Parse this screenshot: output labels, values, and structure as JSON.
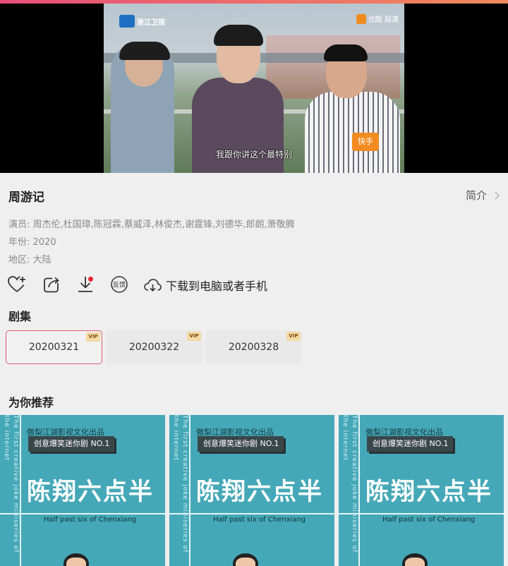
{
  "video": {
    "subtitle": "我跟你讲这个最特别",
    "channel_logo": "浙江卫视",
    "right_logo": "优酷 超清",
    "sponsor_tag": "快手"
  },
  "show": {
    "title": "周游记",
    "intro_label": "简介",
    "cast": "演员: 周杰伦,杜国璋,陈冠霖,蔡威泽,林俊杰,谢霆锋,刘德华,郎朗,萧敬腾",
    "year": "年份: 2020",
    "region": "地区: 大陆"
  },
  "actions": {
    "icons": [
      "heart-plus-icon",
      "share-icon",
      "download-icon",
      "feedback-icon"
    ],
    "feedback_label": "反馈",
    "download_pc_label": "下载到电脑或者手机"
  },
  "episodes": {
    "header": "剧集",
    "items": [
      {
        "label": "20200321",
        "badge": "VIP",
        "active": true
      },
      {
        "label": "20200322",
        "badge": "VIP",
        "active": false
      },
      {
        "label": "20200328",
        "badge": "VIP",
        "active": false
      }
    ]
  },
  "recommend": {
    "header": "为你推荐",
    "items": [
      {
        "studio": "傲梨江湖影视文化出品",
        "tag": "创意爆笑迷你剧 NO.1",
        "title": "陈翔六点半",
        "en": "Half past six of Chenxiang",
        "side_text": "The first creative joke miniseries of the internet"
      },
      {
        "studio": "傲梨江湖影视文化出品",
        "tag": "创意爆笑迷你剧 NO.1",
        "title": "陈翔六点半",
        "en": "Half past six of Chenxiang",
        "side_text": "The first creative joke miniseries of the internet"
      },
      {
        "studio": "傲梨江湖影视文化出品",
        "tag": "创意爆笑迷你剧 NO.1",
        "title": "陈翔六点半",
        "en": "Half past six of Chenxiang",
        "side_text": "The first creative joke miniseries of the internet"
      }
    ]
  },
  "colors": {
    "accent": "#e05a6d",
    "poster": "#45a8b8",
    "vip": "#f3d9a3"
  }
}
